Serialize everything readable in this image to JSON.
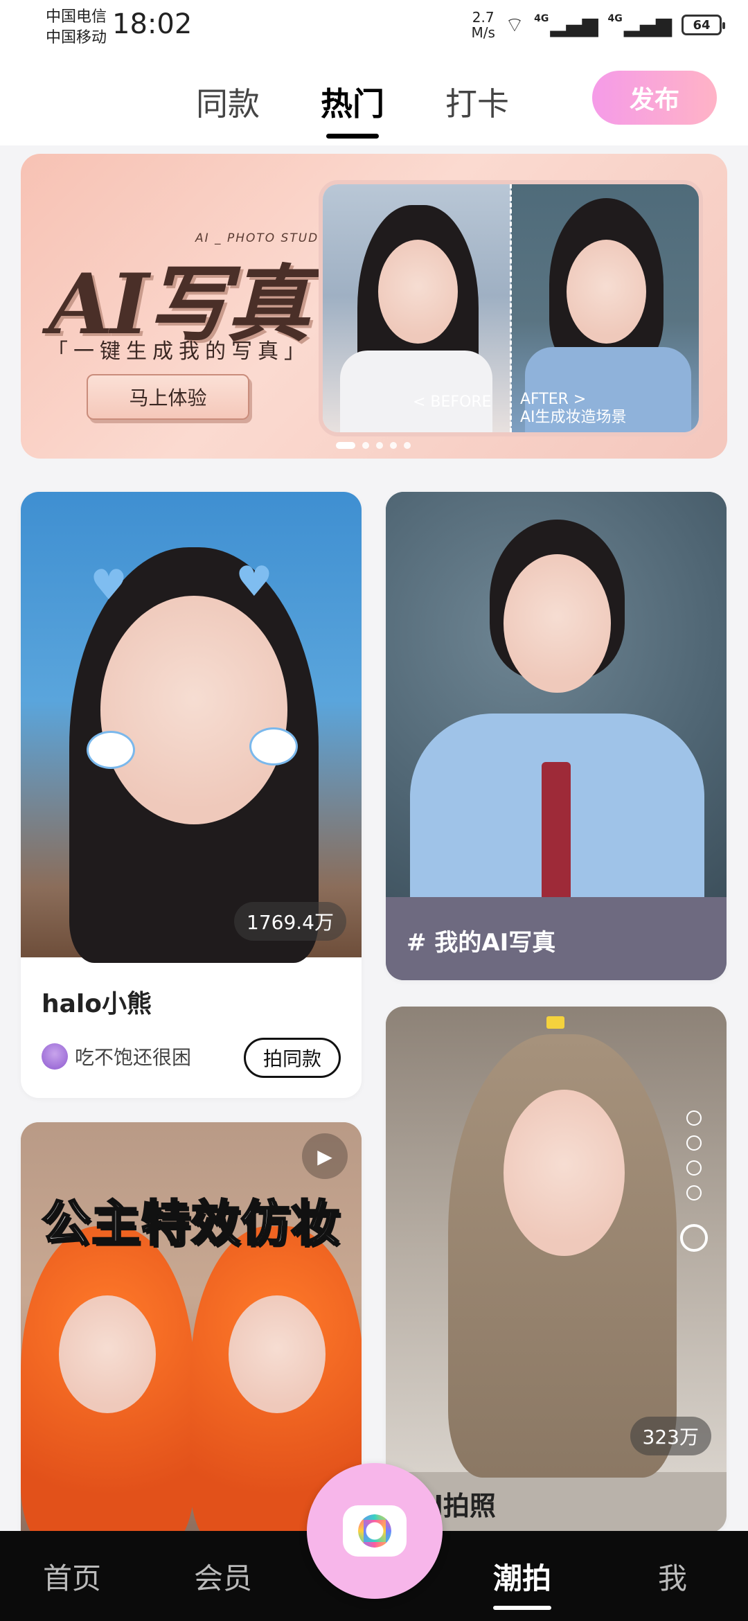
{
  "status_bar": {
    "carrier_1": "中国电信",
    "carrier_2": "中国移动",
    "time": "18:02",
    "speed_value": "2.7",
    "speed_unit": "M/s",
    "net_1": "4G",
    "net_2": "4G",
    "battery": "64"
  },
  "header": {
    "tabs": [
      {
        "label": "同款"
      },
      {
        "label": "热门"
      },
      {
        "label": "打卡"
      }
    ],
    "publish_label": "发布"
  },
  "banner": {
    "subtitle": "AI _ PHOTO STUDIO",
    "title": "AI写真",
    "tagline": "「一键生成我的写真」",
    "cta_label": "马上体验",
    "before_label": "< BEFORE",
    "after_label": "AFTER >",
    "after_caption": "AI生成妆造场景",
    "carousel_count": 5,
    "carousel_active": 0
  },
  "feed": {
    "card1": {
      "count": "1769.4万",
      "title": "halo小熊",
      "author": "吃不饱还很困",
      "button_label": "拍同款"
    },
    "card2": {
      "tag": "# 我的AI写真"
    },
    "card3": {
      "overlay_title": "公主特效仿妆"
    },
    "card4": {
      "count": "323万",
      "title": "ad拍照"
    }
  },
  "bottom_nav": {
    "items": [
      {
        "label": "首页"
      },
      {
        "label": "会员"
      },
      {
        "label": "潮拍"
      },
      {
        "label": "我"
      }
    ],
    "active": "潮拍"
  },
  "colors": {
    "publish_gradient": "#f59be8",
    "fab": "#f7b6ea",
    "tag_bar": "#6e6a80"
  }
}
